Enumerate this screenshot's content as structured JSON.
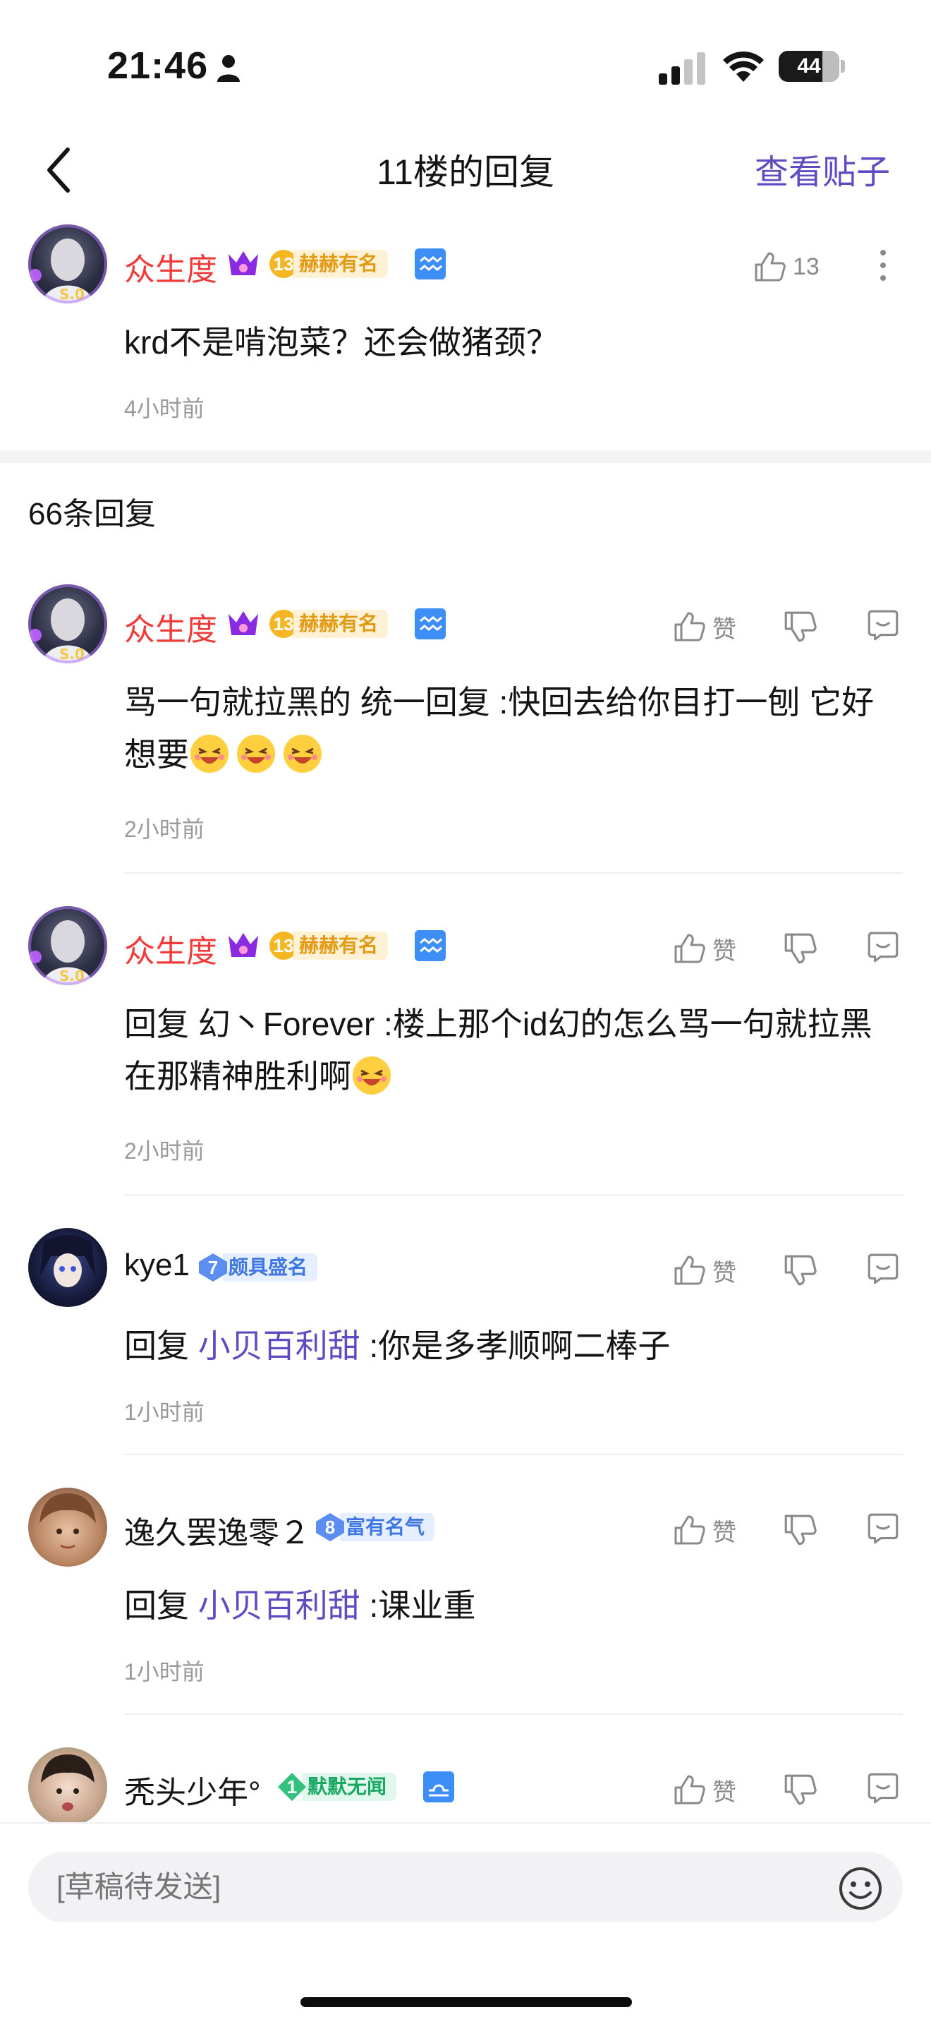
{
  "status_bar": {
    "time": "21:46",
    "battery": "44"
  },
  "nav": {
    "title": "11楼的回复",
    "action": "查看贴子"
  },
  "main_comment": {
    "user": "众生度",
    "level": "13",
    "level_title": "赫赫有名",
    "likes": "13",
    "text": "krd不是啃泡菜？还会做猪颈？",
    "time": "4小时前"
  },
  "replies_header": "66条回复",
  "like_label": "赞",
  "replies": [
    {
      "user": "众生度",
      "level": "13",
      "level_title": "赫赫有名",
      "prefix": "骂一句就拉黑的 统一回复 :快回去给你目打一刨 它好想要",
      "time": "2小时前"
    },
    {
      "user": "众生度",
      "level": "13",
      "level_title": "赫赫有名",
      "prefix": "回复 幻丶Forever :楼上那个id幻的怎么骂一句就拉黑在那精神胜利啊",
      "time": "2小时前"
    },
    {
      "user": "kye1",
      "level": "7",
      "level_title": "颇具盛名",
      "reply_word": "回复 ",
      "reply_to": "小贝百利甜",
      "text": " :你是多孝顺啊二棒子",
      "time": "1小时前"
    },
    {
      "user": "逸久罢逸零２",
      "level": "8",
      "level_title": "富有名气",
      "reply_word": "回复 ",
      "reply_to": "小贝百利甜",
      "text": " :课业重",
      "time": "1小时前"
    },
    {
      "user": "秃头少年°",
      "level": "1",
      "level_title": "默默无闻"
    }
  ],
  "input": {
    "placeholder": "[草稿待发送]"
  },
  "colors": {
    "accent": "#614bc3",
    "vip_name": "#f13b3b",
    "meta": "#9a9a9a"
  }
}
